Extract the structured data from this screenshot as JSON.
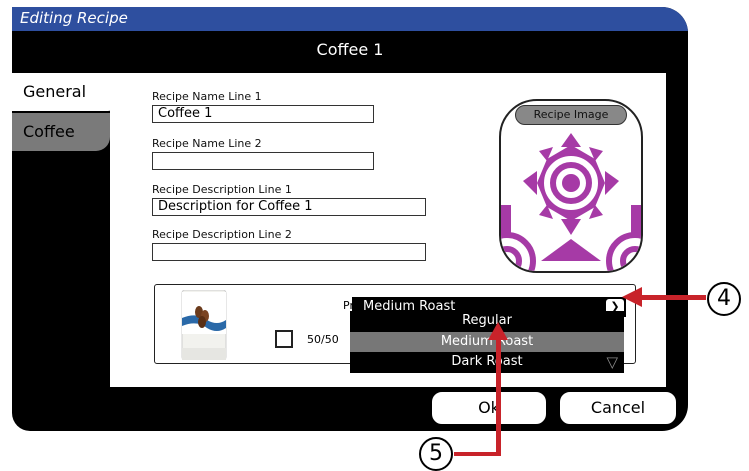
{
  "window": {
    "title": "Editing Recipe",
    "header": "Coffee 1"
  },
  "tabs": [
    {
      "label": "General",
      "active": true
    },
    {
      "label": "Coffee",
      "active": false
    }
  ],
  "form": {
    "name1_label": "Recipe Name Line 1",
    "name1_value": "Coffee 1",
    "name2_label": "Recipe Name Line 2",
    "name2_value": "",
    "desc1_label": "Recipe Description Line 1",
    "desc1_value": "Description for Coffee 1",
    "desc2_label": "Recipe Description Line 2",
    "desc2_value": ""
  },
  "image": {
    "button_label": "Recipe Image"
  },
  "product": {
    "label": "Product",
    "selected": "Medium Roast",
    "checkbox_label": "50/50",
    "checkbox_checked": false,
    "options": [
      "Regular",
      "Medium Roast",
      "Dark Roast"
    ],
    "highlighted_option": "Medium Roast"
  },
  "buttons": {
    "ok": "Ok",
    "cancel": "Cancel"
  },
  "callouts": {
    "c4": "4",
    "c5": "5"
  },
  "colors": {
    "titlebar": "#2e4f9f",
    "pattern": "#a63aa6",
    "arrow": "#c8232a"
  }
}
